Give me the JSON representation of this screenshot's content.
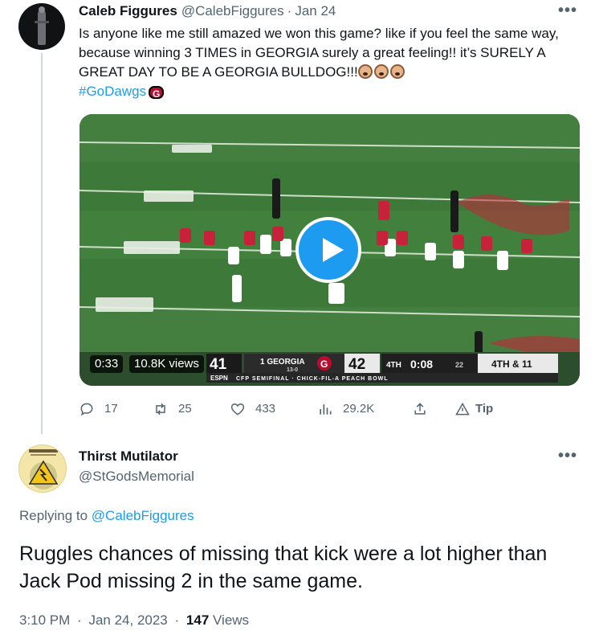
{
  "tweet": {
    "author_name": "Caleb Figgures",
    "author_handle": "@CalebFiggures",
    "separator": "·",
    "date": "Jan 24",
    "more_label": "•••",
    "text_main": "Is anyone like me still amazed we won this game? like if you feel the same way, because winning 3 TIMES in GEORGIA surely a great feeling!! it’s SURELY A GREAT DAY TO BE A GEORGIA BULLDOG!!!",
    "emoji": [
      "dog-face-emoji",
      "dog-face-emoji",
      "dog-face-emoji"
    ],
    "hashtag": "#GoDawgs",
    "hashtag_badge": "G",
    "video": {
      "time": "0:33",
      "views": "10.8K views",
      "scoreboard": {
        "away_score": "41",
        "home_team": "1 GEORGIA",
        "home_record": "13-0",
        "home_score": "42",
        "quarter": "4TH",
        "clock": "0:08",
        "play_clock": "22",
        "down": "4TH & 11",
        "network": "ESPN",
        "bowl": "CFP SEMIFINAL · CHICK-FIL-A PEACH BOWL"
      },
      "field_color": "#3d7a3a"
    },
    "actions": {
      "replies": "17",
      "retweets": "25",
      "likes": "433",
      "views": "29.2K",
      "tip": "Tip"
    }
  },
  "reply": {
    "author_name": "Thirst Mutilator",
    "author_handle": "@StGodsMemorial",
    "more_label": "•••",
    "replying_prefix": "Replying to",
    "replying_to": "@CalebFiggures",
    "text": "Ruggles chances of missing that kick were a lot higher than Jack Pod missing 2 in the same game.",
    "time": "3:10 PM",
    "separator": "·",
    "date": "Jan 24, 2023",
    "view_count": "147",
    "views_label": "Views"
  },
  "colors": {
    "accent": "#1d9bf0",
    "text": "#0f1419",
    "muted": "#536471",
    "georgia_red": "#ba0c2f"
  }
}
